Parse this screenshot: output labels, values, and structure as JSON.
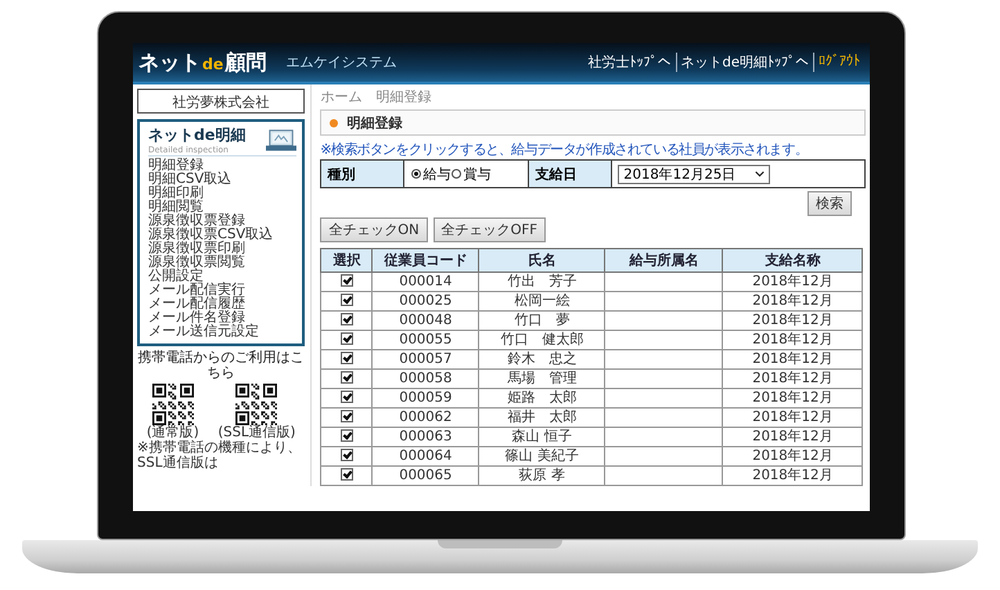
{
  "header": {
    "logo_prefix": "ネット",
    "logo_accent": "de",
    "logo_suffix": "顧問",
    "system_name": "エムケイシステム",
    "links": [
      "社労士ﾄｯﾌﾟへ",
      "ネットde明細ﾄｯﾌﾟへ"
    ],
    "logout": "ﾛｸﾞｱｳﾄ"
  },
  "sidebar": {
    "company_name": "社労夢株式会社",
    "menu": {
      "title": "ネットde明細",
      "subtitle": "Detailed inspection",
      "items": [
        "明細登録",
        "明細CSV取込",
        "明細印刷",
        "明細閲覧",
        "源泉徴収票登録",
        "源泉徴収票CSV取込",
        "源泉徴収票印刷",
        "源泉徴収票閲覧",
        "公開設定",
        "メール配信実行",
        "メール配信履歴",
        "メール件名登録",
        "メール送信元設定"
      ]
    },
    "mobile": {
      "caption": "携帯電話からのご利用はこちら",
      "qr_codes": [
        {
          "label": "(通常版)"
        },
        {
          "label": "(SSL通信版)"
        }
      ],
      "note": "※携帯電話の機種により、SSL通信版は"
    }
  },
  "breadcrumb": [
    "ホーム",
    "明細登録"
  ],
  "page_title": "明細登録",
  "notice": "※検索ボタンをクリックすると、給与データが作成されている社員が表示されます。",
  "filter": {
    "type_label": "種別",
    "options": [
      {
        "label": "給与",
        "selected": true
      },
      {
        "label": "賞与",
        "selected": false
      }
    ],
    "date_label": "支給日",
    "date_value": "2018年12月25日"
  },
  "search_button": "検索",
  "check_buttons": [
    "全チェックON",
    "全チェックOFF"
  ],
  "table": {
    "columns": [
      "選択",
      "従業員コード",
      "氏名",
      "給与所属名",
      "支給名称"
    ],
    "rows": [
      {
        "checked": true,
        "code": "000014",
        "name": "竹出　芳子",
        "pay_name": "2018年12月"
      },
      {
        "checked": true,
        "code": "000025",
        "name": "松岡一絵",
        "pay_name": "2018年12月"
      },
      {
        "checked": true,
        "code": "000048",
        "name": "竹口　夢",
        "pay_name": "2018年12月"
      },
      {
        "checked": true,
        "code": "000055",
        "name": "竹口　健太郎",
        "pay_name": "2018年12月"
      },
      {
        "checked": true,
        "code": "000057",
        "name": "鈴木　忠之",
        "pay_name": "2018年12月"
      },
      {
        "checked": true,
        "code": "000058",
        "name": "馬場　管理",
        "pay_name": "2018年12月"
      },
      {
        "checked": true,
        "code": "000059",
        "name": "姫路　太郎",
        "pay_name": "2018年12月"
      },
      {
        "checked": true,
        "code": "000062",
        "name": "福井　太郎",
        "pay_name": "2018年12月"
      },
      {
        "checked": true,
        "code": "000063",
        "name": "森山 恒子",
        "pay_name": "2018年12月"
      },
      {
        "checked": true,
        "code": "000064",
        "name": "篠山 美紀子",
        "pay_name": "2018年12月"
      },
      {
        "checked": true,
        "code": "000065",
        "name": "荻原 孝",
        "pay_name": "2018年12月"
      }
    ]
  }
}
